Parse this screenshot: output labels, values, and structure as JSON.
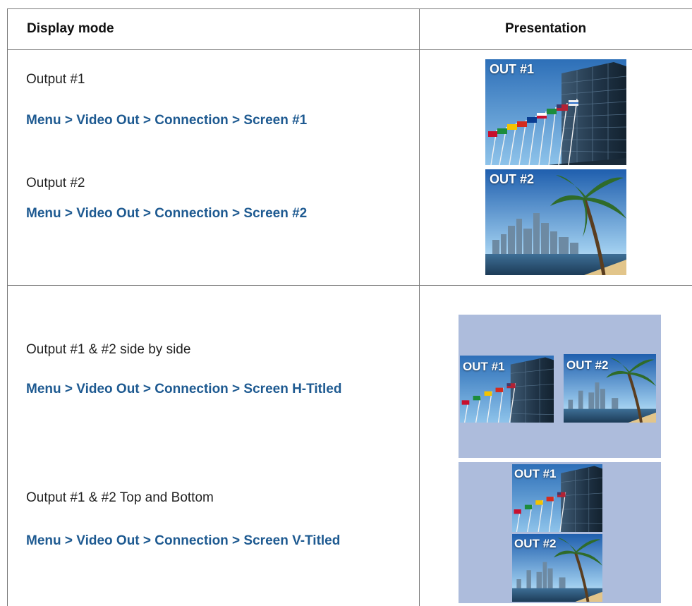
{
  "table": {
    "headers": {
      "display_mode": "Display mode",
      "presentation": "Presentation"
    },
    "rows": [
      {
        "items": [
          {
            "mode": "Output #1",
            "path": "Menu > Video Out > Connection > Screen #1"
          },
          {
            "mode": "Output #2",
            "path": "Menu > Video Out > Connection > Screen #2"
          }
        ]
      },
      {
        "items": [
          {
            "mode": "Output #1 & #2 side by side",
            "path": "Menu > Video Out > Connection > Screen H-Titled"
          },
          {
            "mode": "Output #1 & #2 Top and Bottom",
            "path": "Menu > Video Out > Connection > Screen V-Titled"
          }
        ]
      }
    ]
  },
  "thumbnails": {
    "out1_label": "OUT #1",
    "out2_label": "OUT #2"
  },
  "colors": {
    "path_text": "#1e5a91",
    "panel_background": "#adbcdc",
    "rule": "#7a7a7a"
  }
}
